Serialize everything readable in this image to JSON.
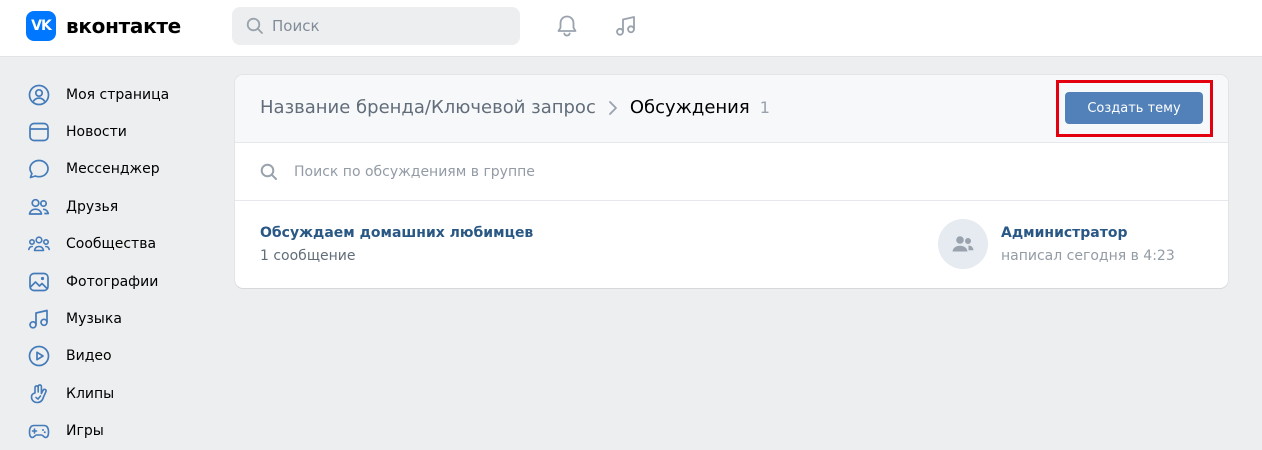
{
  "header": {
    "logo_mark": "VK",
    "logo_text": "вконтакте",
    "search_placeholder": "Поиск",
    "icons": [
      "bell-icon",
      "music-note-icon"
    ]
  },
  "sidebar": {
    "items": [
      {
        "label": "Моя страница",
        "icon": "user-circle-icon"
      },
      {
        "label": "Новости",
        "icon": "news-icon"
      },
      {
        "label": "Мессенджер",
        "icon": "chat-bubble-icon"
      },
      {
        "label": "Друзья",
        "icon": "friends-icon"
      },
      {
        "label": "Сообщества",
        "icon": "communities-icon"
      },
      {
        "label": "Фотографии",
        "icon": "photo-icon"
      },
      {
        "label": "Музыка",
        "icon": "music-icon"
      },
      {
        "label": "Видео",
        "icon": "video-play-icon"
      },
      {
        "label": "Клипы",
        "icon": "clips-icon"
      },
      {
        "label": "Игры",
        "icon": "gamepad-icon"
      }
    ]
  },
  "discussions": {
    "breadcrumb_brand": "Название бренда/Ключевой запрос",
    "breadcrumb_current": "Обсуждения",
    "count": "1",
    "create_button": "Создать тему",
    "search_placeholder": "Поиск по обсуждениям в группе",
    "topics": [
      {
        "title": "Обсуждаем домашних любимцев",
        "messages": "1 сообщение",
        "author": "Администратор",
        "time": "написал сегодня в 4:23"
      }
    ]
  },
  "colors": {
    "accent": "#0077ff",
    "button": "#5181b8",
    "link": "#2a5885",
    "highlight": "#e3000f",
    "icon": "#447bba"
  }
}
